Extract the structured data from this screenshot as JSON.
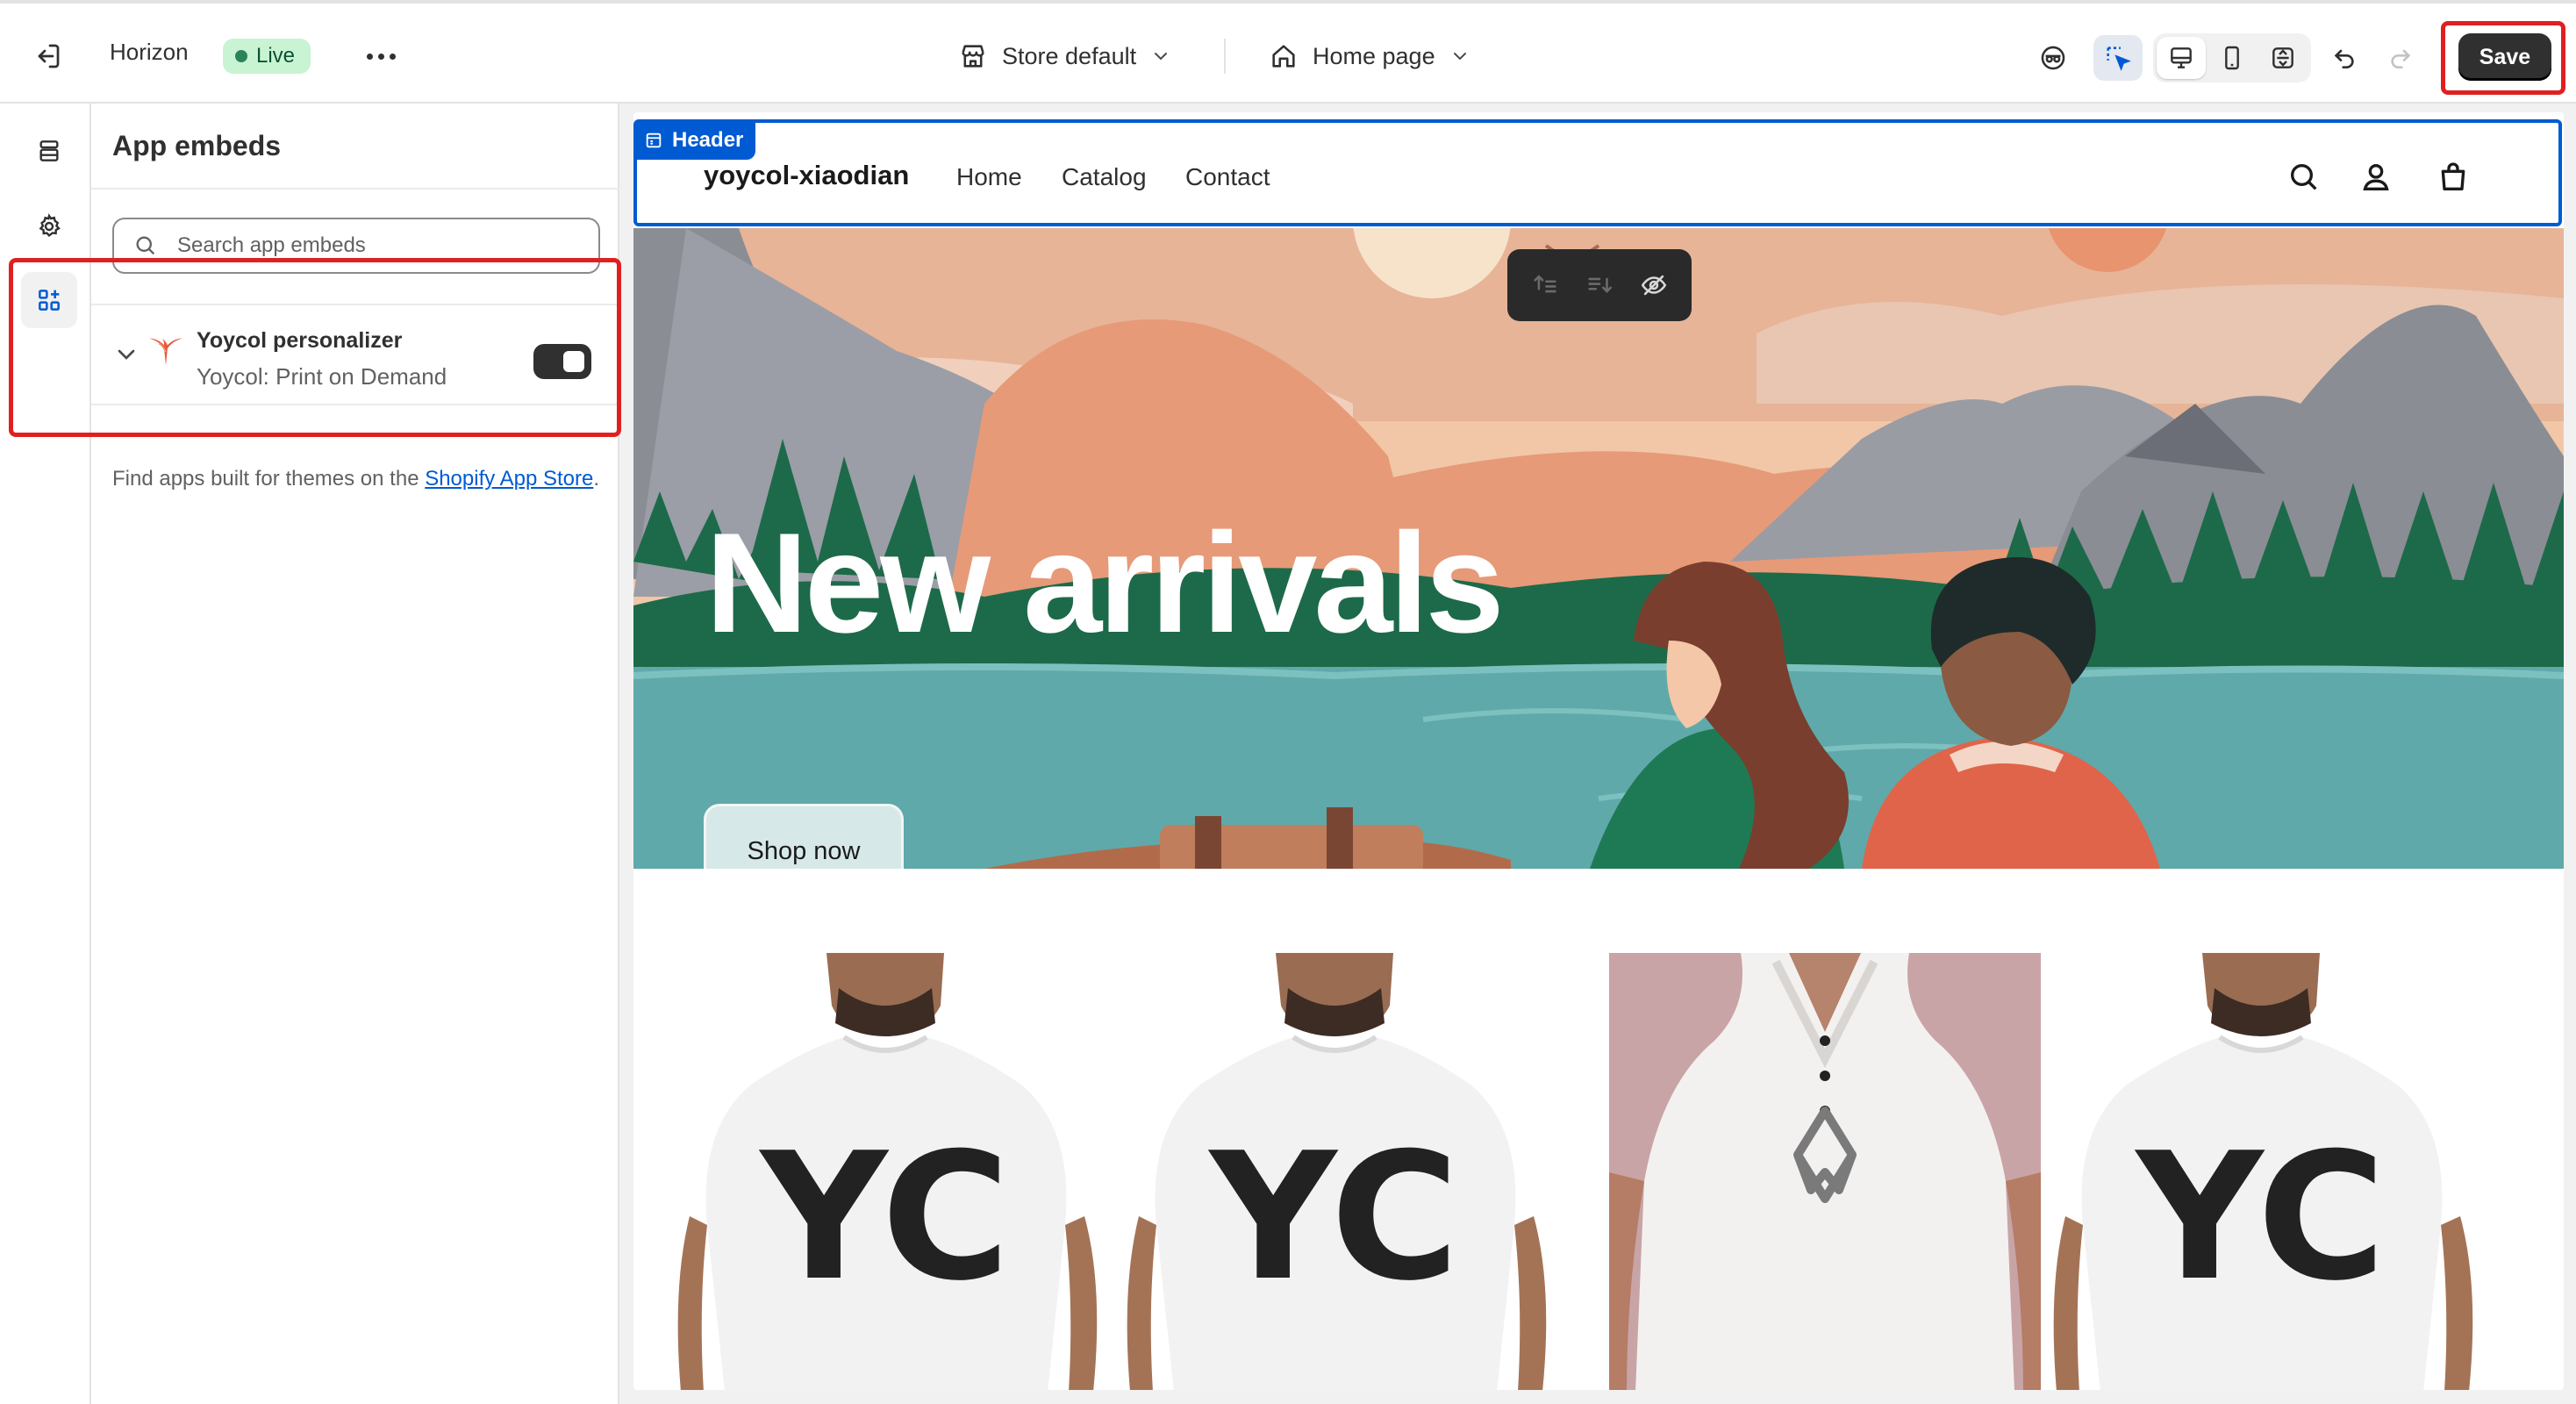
{
  "topbar": {
    "theme_name": "Horizon",
    "status_badge": "Live",
    "store_selector": "Store default",
    "page_selector": "Home page",
    "save_label": "Save"
  },
  "sidebar": {
    "items": [
      {
        "icon": "sections-icon"
      },
      {
        "icon": "gear-icon"
      },
      {
        "icon": "app-embeds-icon",
        "active": true
      }
    ]
  },
  "panel": {
    "title": "App embeds",
    "search_placeholder": "Search app embeds",
    "embeds": [
      {
        "name": "Yoycol personalizer",
        "app": "Yoycol: Print on Demand",
        "enabled": true
      }
    ],
    "find_text": "Find apps built for themes on the ",
    "find_link": "Shopify App Store",
    "find_suffix": "."
  },
  "preview": {
    "header_tag": "Header",
    "brand": "yoycol-xiaodian",
    "nav": [
      "Home",
      "Catalog",
      "Contact"
    ],
    "hero_title": "New arrivals",
    "hero_button": "Shop now",
    "product_prints": [
      "YC",
      "YC",
      "YC"
    ]
  },
  "colors": {
    "accent_blue": "#005bd3",
    "live_green": "#29845a",
    "highlight_red": "#e02020",
    "save_bg": "#303030"
  }
}
